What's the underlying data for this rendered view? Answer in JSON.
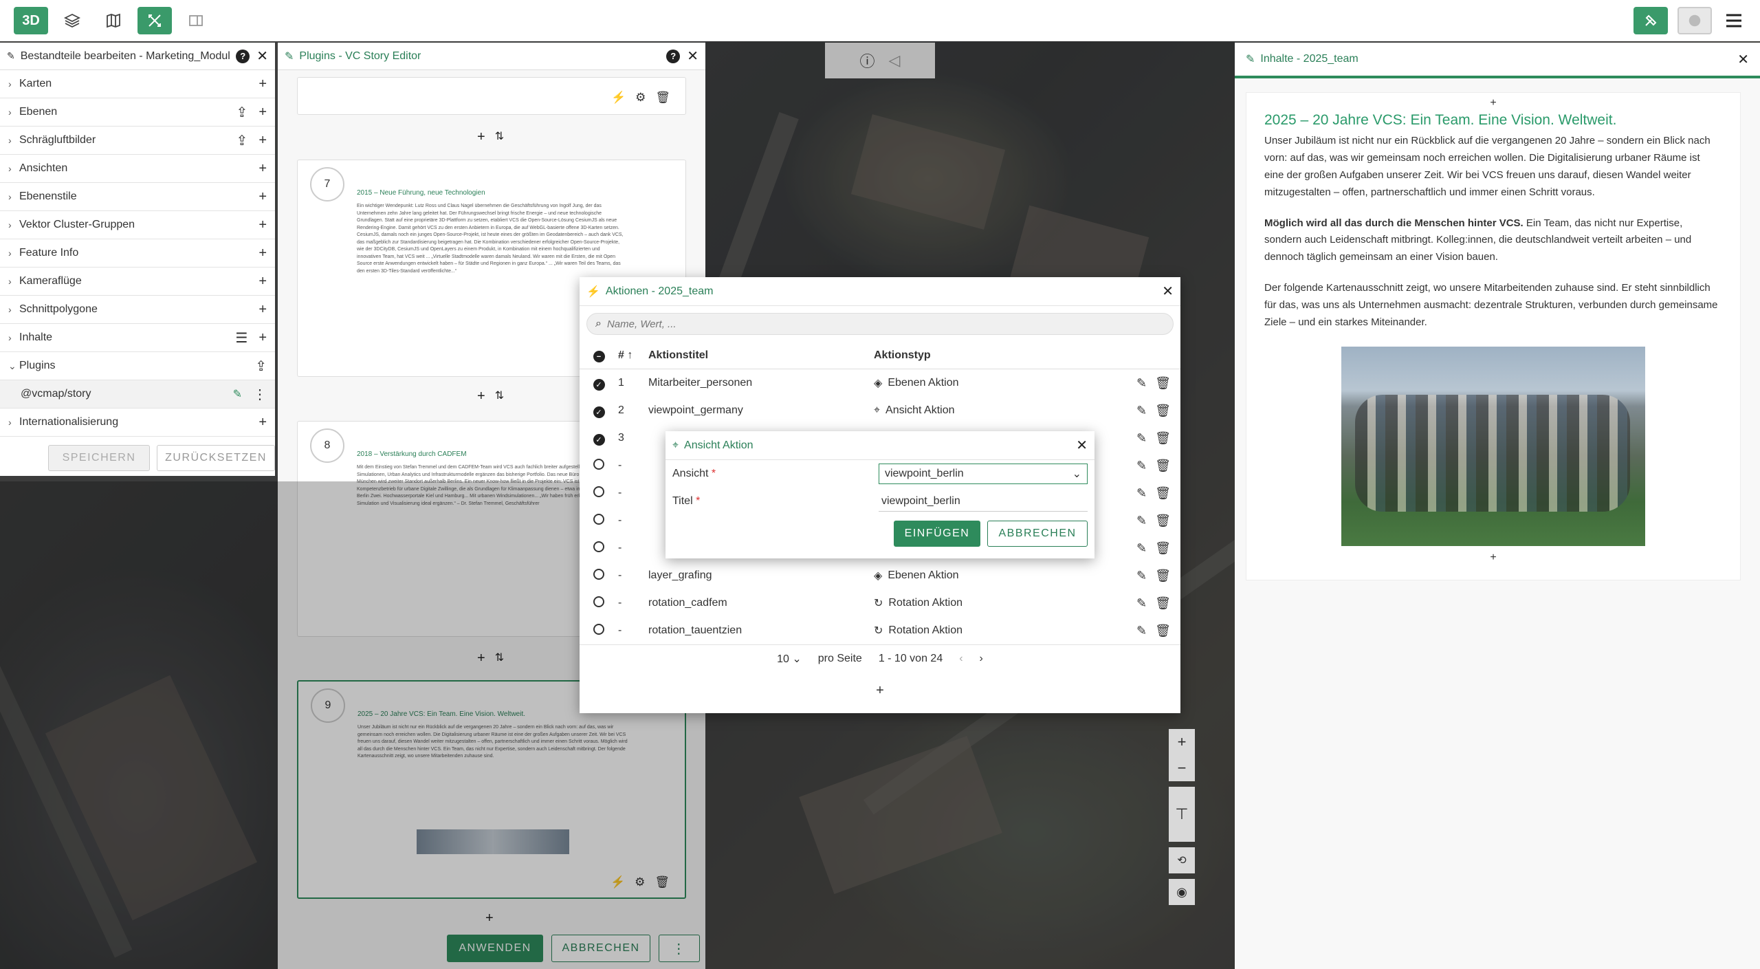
{
  "topbar": {
    "btn_3d": "3D",
    "layers_icon": "layers-icon",
    "map_icon": "map-icon",
    "tools_icon": "tools-icon",
    "sidebar_icon": "sidebar-icon",
    "right_plugin_icon": "puzzle-icon",
    "right_globe_icon": "globe-icon",
    "menu_icon": "hamburger-icon"
  },
  "left_panel": {
    "title": "Bestandteile bearbeiten - Marketing_Modul",
    "items": [
      {
        "label": "Karten",
        "expanded": false,
        "actions": [
          "+"
        ]
      },
      {
        "label": "Ebenen",
        "expanded": false,
        "actions": [
          "upload",
          "+"
        ]
      },
      {
        "label": "Schrägluftbilder",
        "expanded": false,
        "actions": [
          "upload",
          "+"
        ]
      },
      {
        "label": "Ansichten",
        "expanded": false,
        "actions": [
          "+"
        ]
      },
      {
        "label": "Ebenenstile",
        "expanded": false,
        "actions": [
          "+"
        ]
      },
      {
        "label": "Vektor Cluster-Gruppen",
        "expanded": false,
        "actions": [
          "+"
        ]
      },
      {
        "label": "Feature Info",
        "expanded": false,
        "actions": [
          "+"
        ]
      },
      {
        "label": "Kameraflüge",
        "expanded": false,
        "actions": [
          "+"
        ]
      },
      {
        "label": "Schnittpolygone",
        "expanded": false,
        "actions": [
          "+"
        ]
      },
      {
        "label": "Inhalte",
        "expanded": false,
        "actions": [
          "list",
          "+"
        ]
      },
      {
        "label": "Plugins",
        "expanded": true,
        "actions": [
          "upload"
        ]
      },
      {
        "label": "@vcmap/story",
        "sub": true,
        "actions": [
          "edit",
          "more"
        ]
      },
      {
        "label": "Internationalisierung",
        "expanded": false,
        "actions": [
          "+"
        ]
      }
    ],
    "save_label": "SPEICHERN",
    "reset_label": "ZURÜCKSETZEN"
  },
  "story_panel": {
    "title": "Plugins - VC Story Editor",
    "cards": [
      {
        "num": "7",
        "title": "2015 – Neue Führung, neue Technologien",
        "body": "Ein wichtiger Wendepunkt: Lutz Ross und Claus Nagel übernehmen die Geschäftsführung von Ingolf Jung, der das Unternehmen zehn Jahre lang geleitet hat. Der Führungswechsel bringt frische Energie – und neue technologische Grundlagen. Statt auf eine proprietäre 3D-Plattform zu setzen, etabliert VCS die Open-Source-Lösung CesiumJS als neue Rendering-Engine. Damit gehört VCS zu den ersten Anbietern in Europa, die auf WebGL-basierte offene 3D-Karten setzen. CesiumJS, damals noch ein junges Open-Source-Projekt, ist heute eines der größten im Geodatenbereich – auch dank VCS, das maßgeblich zur Standardisierung beigetragen hat. Die Kombination verschiedener erfolgreicher Open-Source-Projekte, wie der 3DCityDB, CesiumJS und OpenLayers zu einem Produkt, in Kombination mit einem hochqualifizierten und innovativen Team, hat VCS weit ... „Virtuelle Stadtmodelle waren damals Neuland. Wir waren mit die Ersten, die mit Open Source erste Anwendungen entwickelt haben – für Städte und Regionen in ganz Europa.“ ... „Wir waren Teil des Teams, das den ersten 3D-Tiles-Standard veröffentlichte...“"
      },
      {
        "num": "8",
        "title": "2018 – Verstärkung durch CADFEM",
        "body": "Mit dem Einstieg von Stefan Tremmel und dem CADFEM-Team wird VCS auch fachlich breiter aufgestellt: Physikalische Simulationen, Urban Analytics und Infrastrukturmodelle ergänzen das bisherige Portfolio. Das neue Büro in Grafing bei München wird zweiter Standort außerhalb Berlins. Ein neuer Know-how fließt in die Projekte ein: VCS ist ein Kompetenzbetrieb für urbane Digitale Zwillinge, die als Grundlagen für Klimaanpassung dienen – etwa im Leuchtturmprojekt Berlin Zwei. Hochwasserportale Kiel und Hamburg... Mit urbanen Windsimulationen... „Wir haben früh erkannt, dass sich Simulation und Visualisierung ideal ergänzen.“ – Dr. Stefan Tremmel, Geschäftsführer"
      },
      {
        "num": "9",
        "title": "2025 – 20 Jahre VCS: Ein Team. Eine Vision. Weltweit.",
        "body": "Unser Jubiläum ist nicht nur ein Rückblick auf die vergangenen 20 Jahre – sondern ein Blick nach vorn: auf das, was wir gemeinsam noch erreichen wollen. Die Digitalisierung urbaner Räume ist eine der großen Aufgaben unserer Zeit. Wir bei VCS freuen uns darauf, diesen Wandel weiter mitzugestalten – offen, partnerschaftlich und immer einen Schritt voraus. Möglich wird all das durch die Menschen hinter VCS. Ein Team, das nicht nur Expertise, sondern auch Leidenschaft mitbringt. Der folgende Kartenausschnitt zeigt, wo unsere Mitarbeitenden zuhause sind."
      }
    ],
    "apply_label": "ANWENDEN",
    "cancel_label": "ABBRECHEN"
  },
  "right_panel": {
    "title": "Inhalte - 2025_team",
    "heading": "2025 – 20 Jahre VCS: Ein Team. Eine Vision. Weltweit.",
    "p1": "Unser Jubiläum ist nicht nur ein Rückblick auf die vergangenen 20 Jahre – sondern ein Blick nach vorn: auf das, was wir gemeinsam noch erreichen wollen. Die Digitalisierung urbaner Räume ist eine der großen Aufgaben unserer Zeit. Wir bei VCS freuen uns darauf, diesen Wandel weiter mitzugestalten – offen, partnerschaftlich und immer einen Schritt voraus.",
    "p2_bold": "Möglich wird all das durch die Menschen hinter VCS.",
    "p2_rest": " Ein Team, das nicht nur Expertise, sondern auch Leidenschaft mitbringt. Kolleg:innen, die deutschlandweit verteilt arbeiten – und dennoch täglich gemeinsam an einer Vision bauen.",
    "p3": "Der folgende Kartenausschnitt zeigt, wo unsere Mitarbeitenden zuhause sind. Er steht sinnbildlich für das, was uns als Unternehmen ausmacht: dezentrale Strukturen, verbunden durch gemeinsame Ziele – und ein starkes Miteinander."
  },
  "actions_dialog": {
    "title": "Aktionen - 2025_team",
    "search_placeholder": "Name, Wert, ...",
    "col_num": "#",
    "col_title": "Aktionstitel",
    "col_type": "Aktionstyp",
    "rows": [
      {
        "selected": true,
        "num": "1",
        "title": "Mitarbeiter_personen",
        "type": "Ebenen Aktion",
        "icon": "layers-icon"
      },
      {
        "selected": true,
        "num": "2",
        "title": "viewpoint_germany",
        "type": "Ansicht Aktion",
        "icon": "viewpoint-icon"
      },
      {
        "selected": true,
        "num": "3",
        "title": "",
        "type": "",
        "icon": ""
      },
      {
        "selected": false,
        "num": "-",
        "title": "",
        "type": "",
        "icon": ""
      },
      {
        "selected": false,
        "num": "-",
        "title": "",
        "type": "",
        "icon": ""
      },
      {
        "selected": false,
        "num": "-",
        "title": "",
        "type": "",
        "icon": ""
      },
      {
        "selected": false,
        "num": "-",
        "title": "",
        "type": "",
        "icon": ""
      },
      {
        "selected": false,
        "num": "-",
        "title": "layer_grafing",
        "type": "Ebenen Aktion",
        "icon": "layers-icon"
      },
      {
        "selected": false,
        "num": "-",
        "title": "rotation_cadfem",
        "type": "Rotation Aktion",
        "icon": "rotation-icon"
      },
      {
        "selected": false,
        "num": "-",
        "title": "rotation_tauentzien",
        "type": "Rotation Aktion",
        "icon": "rotation-icon"
      }
    ],
    "per_page_value": "10",
    "per_page_label": "pro Seite",
    "range_label": "1 - 10 von 24"
  },
  "view_dialog": {
    "title": "Ansicht Aktion",
    "view_label": "Ansicht",
    "view_value": "viewpoint_berlin",
    "title_label": "Titel",
    "title_value": "viewpoint_berlin",
    "insert_label": "EINFÜGEN",
    "cancel_label": "ABBRECHEN"
  },
  "colors": {
    "accent": "#2e8b5c",
    "accent_text": "#2a7f57"
  }
}
